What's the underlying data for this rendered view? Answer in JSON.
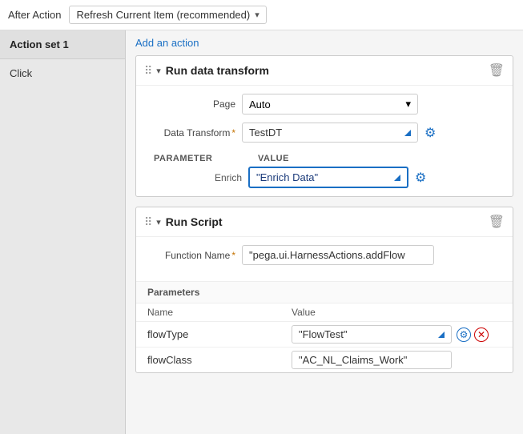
{
  "header": {
    "label": "After Action",
    "dropdown_value": "Refresh Current Item (recommended)",
    "dropdown_icon": "▾"
  },
  "sidebar": {
    "section_title": "Action set 1",
    "items": [
      {
        "label": "Click"
      }
    ]
  },
  "content": {
    "add_action_label": "Add an action",
    "actions": [
      {
        "id": "action1",
        "title": "Run data transform",
        "fields": [
          {
            "label": "Page",
            "type": "select",
            "value": "Auto"
          },
          {
            "label": "Data Transform",
            "type": "input",
            "value": "TestDT",
            "required": true
          }
        ],
        "param_header": [
          "PARAMETER",
          "VALUE"
        ],
        "params": [
          {
            "name": "Enrich",
            "value": "\"Enrich Data\""
          }
        ]
      },
      {
        "id": "action2",
        "title": "Run Script",
        "fields": [
          {
            "label": "Function Name",
            "type": "input",
            "value": "\"pega.ui.HarnessActions.addFlow",
            "required": true
          }
        ],
        "has_params": true,
        "params_header": "Parameters",
        "param_columns": [
          "Name",
          "Value"
        ],
        "param_rows": [
          {
            "name": "flowType",
            "value": "\"FlowTest\""
          },
          {
            "name": "flowClass",
            "value": "\"AC_NL_Claims_Work\""
          }
        ]
      }
    ]
  }
}
